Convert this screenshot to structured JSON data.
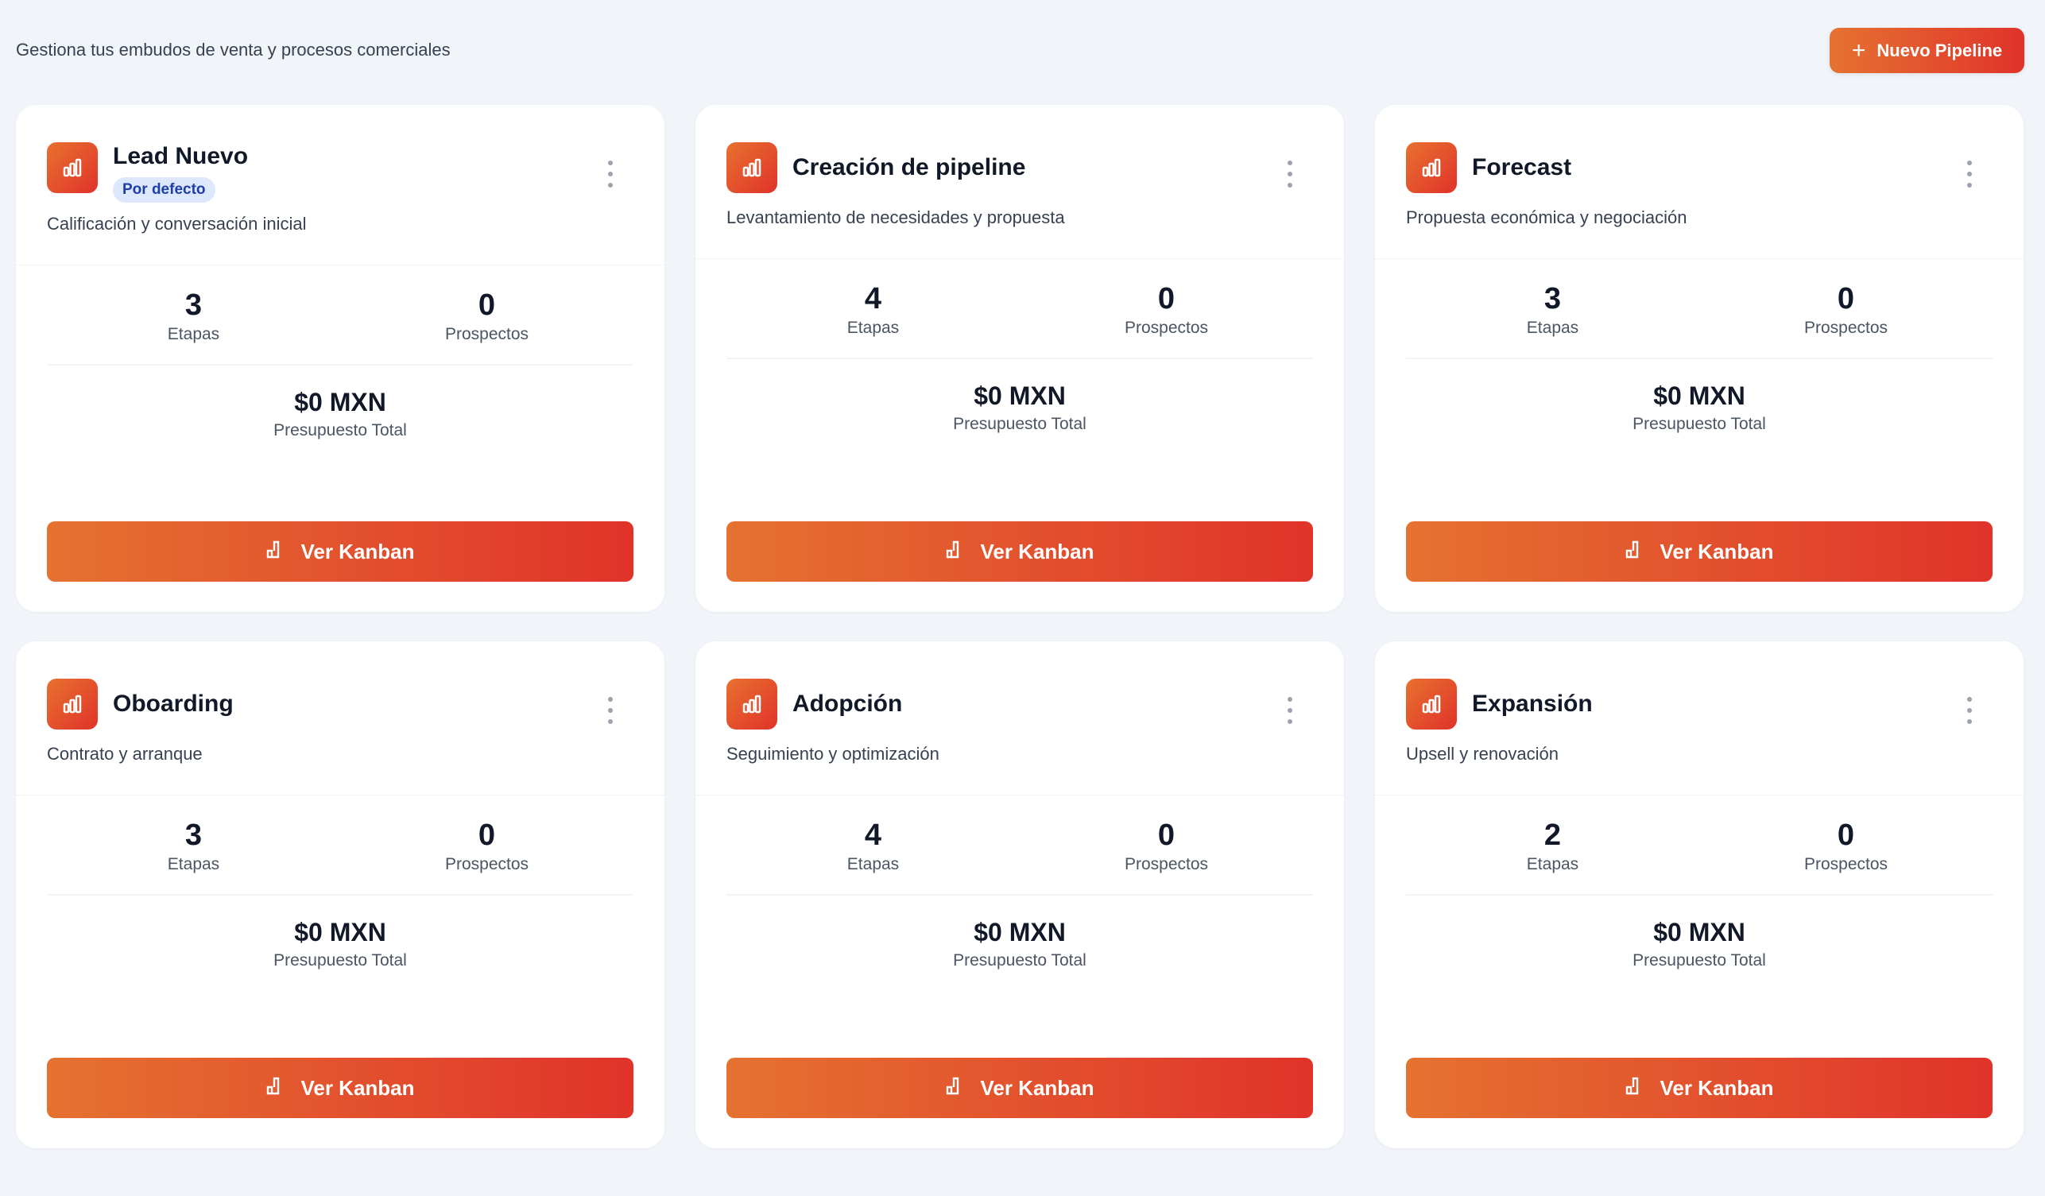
{
  "header": {
    "subtitle": "Gestiona tus embudos de venta y procesos comerciales",
    "new_button": "Nuevo Pipeline"
  },
  "colors": {
    "accent_start": "#e57231",
    "accent_end": "#e0332a",
    "badge_bg": "#dde8fc"
  },
  "pipelines": [
    {
      "title": "Lead Nuevo",
      "badge": "Por defecto",
      "description": "Calificación y conversación inicial",
      "stages": "3",
      "stages_label": "Etapas",
      "prospects": "0",
      "prospects_label": "Prospectos",
      "budget": "$0 MXN",
      "budget_label": "Presupuesto Total",
      "button": "Ver Kanban"
    },
    {
      "title": "Creación de pipeline",
      "description": "Levantamiento de necesidades y propuesta",
      "stages": "4",
      "stages_label": "Etapas",
      "prospects": "0",
      "prospects_label": "Prospectos",
      "budget": "$0 MXN",
      "budget_label": "Presupuesto Total",
      "button": "Ver Kanban"
    },
    {
      "title": "Forecast",
      "description": "Propuesta económica y negociación",
      "stages": "3",
      "stages_label": "Etapas",
      "prospects": "0",
      "prospects_label": "Prospectos",
      "budget": "$0 MXN",
      "budget_label": "Presupuesto Total",
      "button": "Ver Kanban"
    },
    {
      "title": "Oboarding",
      "description": "Contrato y arranque",
      "stages": "3",
      "stages_label": "Etapas",
      "prospects": "0",
      "prospects_label": "Prospectos",
      "budget": "$0 MXN",
      "budget_label": "Presupuesto Total",
      "button": "Ver Kanban"
    },
    {
      "title": "Adopción",
      "description": "Seguimiento y optimización",
      "stages": "4",
      "stages_label": "Etapas",
      "prospects": "0",
      "prospects_label": "Prospectos",
      "budget": "$0 MXN",
      "budget_label": "Presupuesto Total",
      "button": "Ver Kanban"
    },
    {
      "title": "Expansión",
      "description": "Upsell y renovación",
      "stages": "2",
      "stages_label": "Etapas",
      "prospects": "0",
      "prospects_label": "Prospectos",
      "budget": "$0 MXN",
      "budget_label": "Presupuesto Total",
      "button": "Ver Kanban"
    }
  ]
}
